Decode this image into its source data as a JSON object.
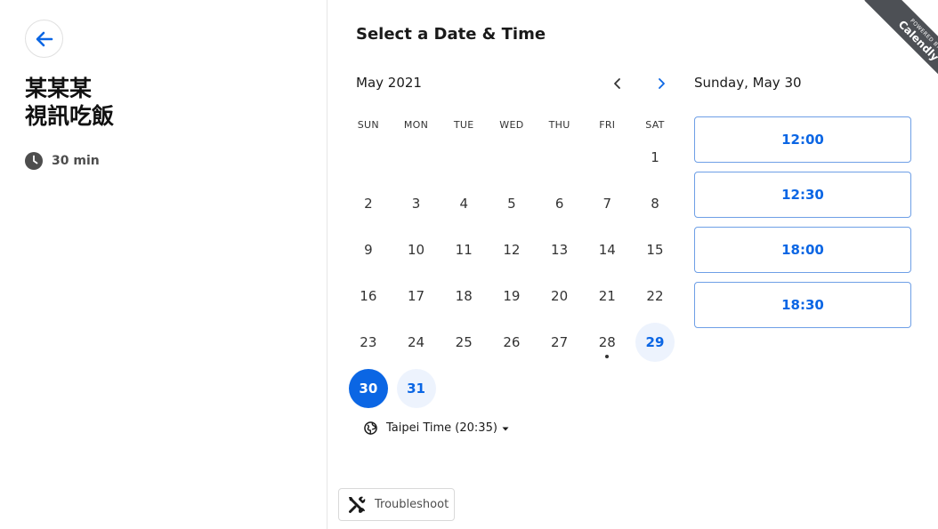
{
  "event": {
    "title": "某某某\n視訊吃飯",
    "duration": "30 min"
  },
  "main": {
    "title": "Select a Date & Time",
    "month": "May 2021",
    "weekdays": [
      "SUN",
      "MON",
      "TUE",
      "WED",
      "THU",
      "FRI",
      "SAT"
    ],
    "first_weekday_index": 6,
    "days": [
      {
        "n": "1"
      },
      {
        "n": "2"
      },
      {
        "n": "3"
      },
      {
        "n": "4"
      },
      {
        "n": "5"
      },
      {
        "n": "6"
      },
      {
        "n": "7"
      },
      {
        "n": "8"
      },
      {
        "n": "9"
      },
      {
        "n": "10"
      },
      {
        "n": "11"
      },
      {
        "n": "12"
      },
      {
        "n": "13"
      },
      {
        "n": "14"
      },
      {
        "n": "15"
      },
      {
        "n": "16"
      },
      {
        "n": "17"
      },
      {
        "n": "18"
      },
      {
        "n": "19"
      },
      {
        "n": "20"
      },
      {
        "n": "21"
      },
      {
        "n": "22"
      },
      {
        "n": "23"
      },
      {
        "n": "24"
      },
      {
        "n": "25"
      },
      {
        "n": "26"
      },
      {
        "n": "27"
      },
      {
        "n": "28",
        "today": true
      },
      {
        "n": "29",
        "available": true
      },
      {
        "n": "30",
        "selected": true
      },
      {
        "n": "31",
        "available": true
      }
    ],
    "timezone": "Taipei Time (20:35)"
  },
  "slots": {
    "date_heading": "Sunday, May 30",
    "times": [
      "12:00",
      "12:30",
      "18:00",
      "18:30"
    ]
  },
  "troubleshoot": {
    "label": "Troubleshoot"
  },
  "ribbon": {
    "small": "POWERED BY",
    "brand": "Calendly"
  },
  "colors": {
    "accent": "#0b66e4",
    "available_bg": "#edf3fd",
    "ribbon": "#4d5055"
  },
  "icons": {
    "back": "arrow-left-icon",
    "clock": "clock-icon",
    "prev": "chevron-left-icon",
    "next": "chevron-right-icon",
    "globe": "globe-icon",
    "caret": "caret-down-icon",
    "wrench": "wrench-icon"
  }
}
